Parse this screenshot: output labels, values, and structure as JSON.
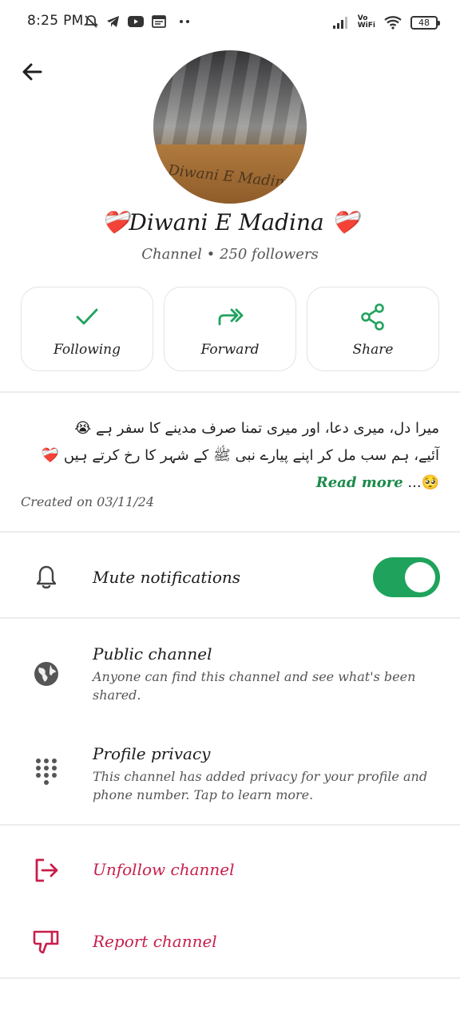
{
  "status_bar": {
    "time": "8:25 PM",
    "vowifi_line1": "Vo",
    "vowifi_line2": "WiFi",
    "battery": "48",
    "icons": [
      "mute-icon",
      "telegram-icon",
      "youtube-icon",
      "news-icon",
      "more-dots-icon",
      "signal-icon",
      "vowifi-icon",
      "wifi-icon",
      "battery-icon"
    ]
  },
  "header": {
    "back_icon": "arrow-left-icon"
  },
  "channel": {
    "name": "Diwani E Madina",
    "name_emoji_left": "❤️‍🩹",
    "name_emoji_right": "❤️‍🩹",
    "subtitle": "Channel • 250 followers",
    "avatar_ink": "Diwani E Madina"
  },
  "actions": [
    {
      "label": "Following",
      "icon": "check-icon"
    },
    {
      "label": "Forward",
      "icon": "forward-icon"
    },
    {
      "label": "Share",
      "icon": "share-icon"
    }
  ],
  "description": {
    "line1": "میرا دل، میری دعا، اور میری تمنا صرف مدینے کا سفر ہے 😭",
    "line2": "آئیے، ہم سب مل کر اپنے پیارے نبی ﷺ کے شہر کا رخ کرتے ہیں ❤️‍🩹",
    "line3_prefix": "🥺...",
    "read_more": "Read more"
  },
  "created": "Created on 03/11/24",
  "settings": {
    "mute": {
      "label": "Mute notifications",
      "icon": "bell-icon",
      "enabled": true
    },
    "public": {
      "title": "Public channel",
      "subtitle": "Anyone can find this channel and see what's been shared.",
      "icon": "globe-icon"
    },
    "privacy": {
      "title": "Profile privacy",
      "subtitle": "This channel has added privacy for your profile and phone number. Tap to learn more.",
      "icon": "dialpad-icon"
    }
  },
  "danger_actions": {
    "unfollow": {
      "label": "Unfollow channel",
      "icon": "exit-icon"
    },
    "report": {
      "label": "Report channel",
      "icon": "thumbs-down-icon"
    }
  },
  "colors": {
    "accent_green": "#1fa35c",
    "danger_red": "#c81e4b"
  }
}
